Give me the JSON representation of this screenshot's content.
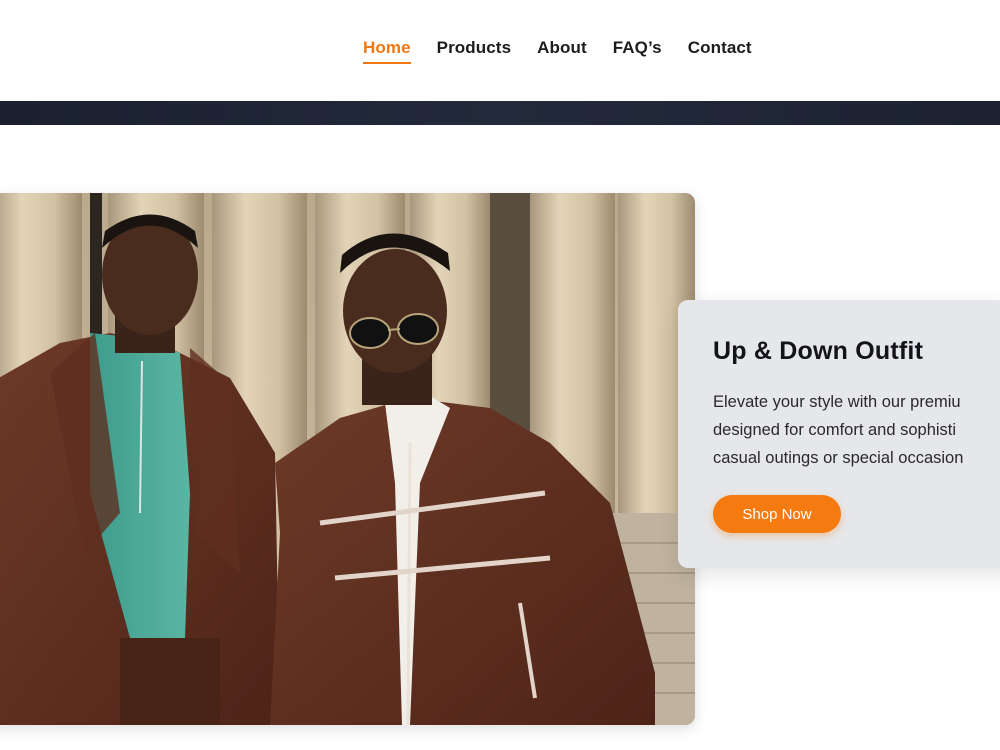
{
  "nav": {
    "items": [
      {
        "label": "Home",
        "active": true
      },
      {
        "label": "Products",
        "active": false
      },
      {
        "label": "About",
        "active": false
      },
      {
        "label": "FAQ’s",
        "active": false
      },
      {
        "label": "Contact",
        "active": false
      }
    ]
  },
  "hero": {
    "image_subject": "two men in brown tracksuits in front of stone columns"
  },
  "card": {
    "title": "Up & Down Outfit",
    "desc_lines": [
      "Elevate your style with our premiu",
      "designed for comfort and sophisti",
      "casual outings or special occasion"
    ],
    "button_label": "Shop Now"
  },
  "colors": {
    "accent": "#f07814",
    "button": "#f57a10",
    "band": "#1c2232",
    "card_bg": "#e6e7ea"
  }
}
